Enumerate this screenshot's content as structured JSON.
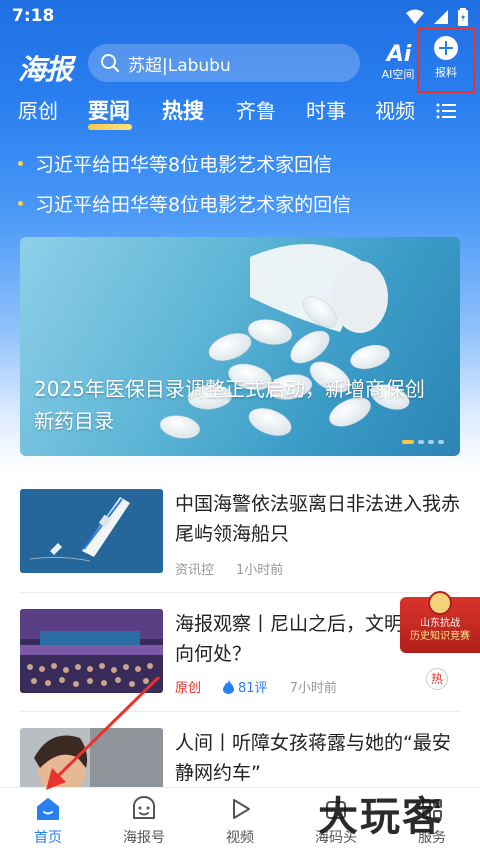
{
  "status_bar": {
    "time": "7:18"
  },
  "header": {
    "logo": "海报",
    "search_text": "苏超|Labubu",
    "ai_button_label": "AI空间",
    "report_button_label": "报料"
  },
  "tabs": [
    {
      "label": "原创"
    },
    {
      "label": "要闻"
    },
    {
      "label": "热搜"
    },
    {
      "label": "齐鲁"
    },
    {
      "label": "时事"
    },
    {
      "label": "视频"
    }
  ],
  "ticker": [
    "习近平给田华等8位电影艺术家回信",
    "习近平给田华等8位电影艺术家的回信"
  ],
  "banner": {
    "caption": "2025年医保目录调整正式启动，新增商保创新药目录"
  },
  "news": [
    {
      "title": "中国海警依法驱离日非法进入我赤尾屿领海船只",
      "source": "资讯控",
      "time": "1小时前"
    },
    {
      "title": "海报观察丨尼山之后，文明对话走向何处？",
      "tag": "原创",
      "comments": "81评",
      "time": "7小时前"
    },
    {
      "title": "人间丨听障女孩蒋露与她的“最安静网约车”"
    }
  ],
  "float_badge": {
    "line1": "山东抗战",
    "line2": "历史知识竞赛"
  },
  "hot_tag": "热",
  "bottom_nav": [
    {
      "label": "首页"
    },
    {
      "label": "海报号"
    },
    {
      "label": "视频"
    },
    {
      "label": "海码头"
    },
    {
      "label": "服务"
    }
  ],
  "watermark": "大玩客",
  "colors": {
    "brand_blue": "#2a7ff0",
    "highlight_red": "#e8322b",
    "tab_underline": "#f7c848"
  }
}
